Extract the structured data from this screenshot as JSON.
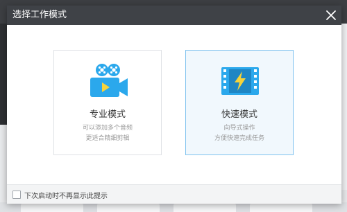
{
  "dialog": {
    "title": "选择工作模式",
    "close_icon": "close-icon"
  },
  "modes": [
    {
      "title": "专业模式",
      "desc_line1": "可以添加多个音频",
      "desc_line2": "更适合精细剪辑",
      "icon": "movie-camera-icon",
      "selected": false
    },
    {
      "title": "快速模式",
      "desc_line1": "向导式操作",
      "desc_line2": "方便快速完成任务",
      "icon": "film-lightning-icon",
      "selected": true
    }
  ],
  "footer": {
    "checkbox_label": "下次启动时不再显示此提示",
    "checked": false
  },
  "colors": {
    "header_bg": "#3f4247",
    "accent_blue": "#2ba8ec",
    "selected_border": "#7fc2ef",
    "selected_bg": "#f1f8fd"
  }
}
